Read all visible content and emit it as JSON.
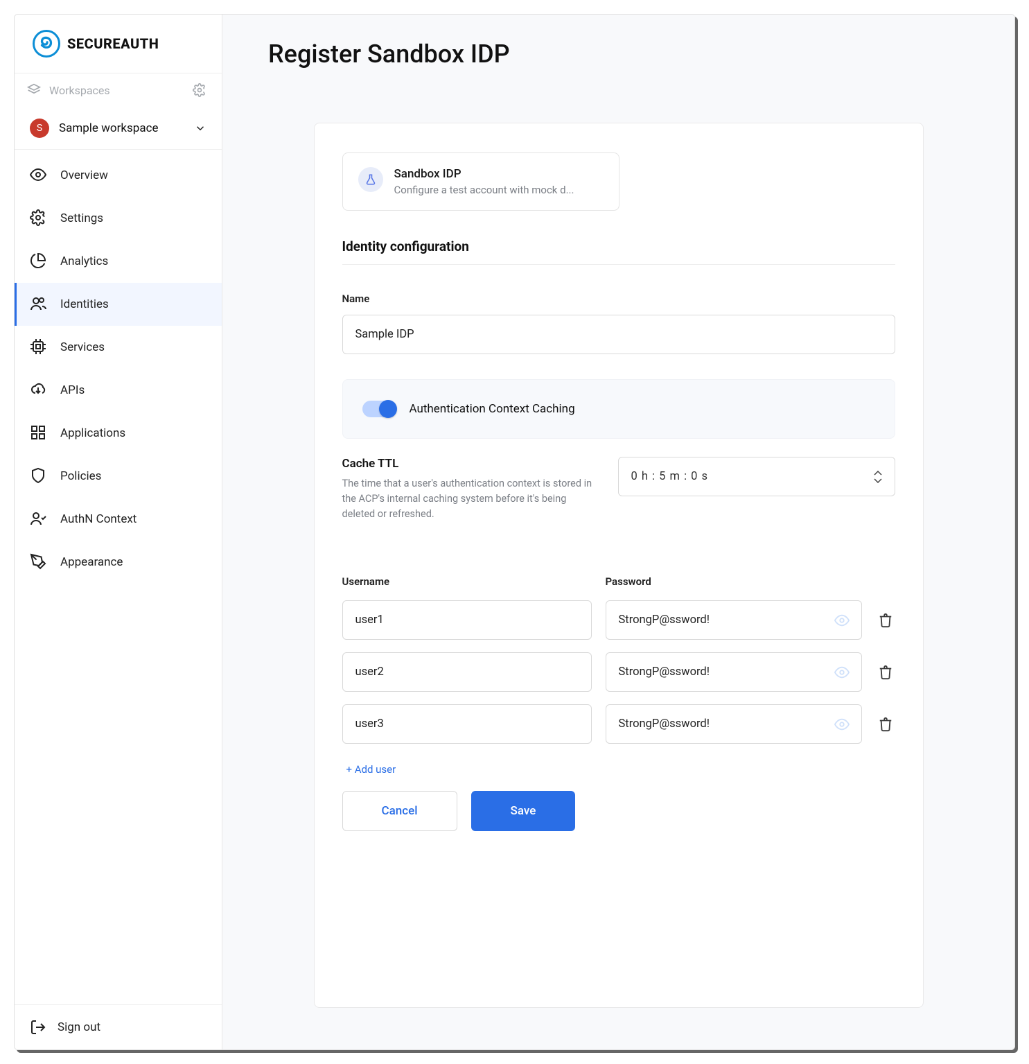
{
  "brand": {
    "text": "SECUREAUTH"
  },
  "workspaces": {
    "label": "Workspaces",
    "selected": "Sample workspace",
    "selected_initial": "S"
  },
  "nav": {
    "items": [
      {
        "label": "Overview"
      },
      {
        "label": "Settings"
      },
      {
        "label": "Analytics"
      },
      {
        "label": "Identities"
      },
      {
        "label": "Services"
      },
      {
        "label": "APIs"
      },
      {
        "label": "Applications"
      },
      {
        "label": "Policies"
      },
      {
        "label": "AuthN Context"
      },
      {
        "label": "Appearance"
      }
    ],
    "signout": "Sign out"
  },
  "page": {
    "title": "Register Sandbox IDP"
  },
  "idp_card": {
    "title": "Sandbox IDP",
    "desc": "Configure a test account with mock d..."
  },
  "section": {
    "identity_config": "Identity configuration"
  },
  "form": {
    "name_label": "Name",
    "name_value": "Sample IDP",
    "toggle_label": "Authentication Context Caching",
    "cache_ttl": {
      "heading": "Cache TTL",
      "desc": "The time that a user's authentication context is stored in the ACP's internal caching system before it's being deleted or refreshed.",
      "value": "0 h : 5 m : 0 s"
    },
    "username_label": "Username",
    "password_label": "Password",
    "users": [
      {
        "username": "user1",
        "password": "StrongP@ssword!"
      },
      {
        "username": "user2",
        "password": "StrongP@ssword!"
      },
      {
        "username": "user3",
        "password": "StrongP@ssword!"
      }
    ],
    "add_user": "+ Add user",
    "cancel": "Cancel",
    "save": "Save"
  }
}
